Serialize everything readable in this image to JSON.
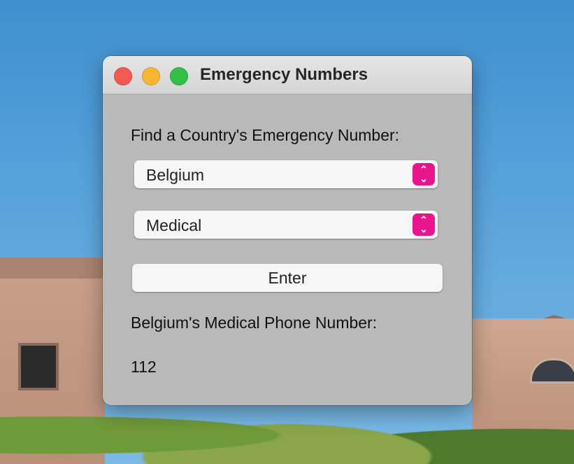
{
  "window": {
    "title": "Emergency Numbers"
  },
  "form": {
    "heading": "Find a Country's Emergency Number:",
    "country_select": {
      "value": "Belgium"
    },
    "service_select": {
      "value": "Medical"
    },
    "enter_label": "Enter",
    "result_label": "Belgium's Medical Phone Number:",
    "result_value": "112"
  },
  "colors": {
    "accent": "#e8158f",
    "window_bg": "#b9b9b9"
  },
  "icons": {
    "stepper": "up-down-chevron-icon"
  }
}
